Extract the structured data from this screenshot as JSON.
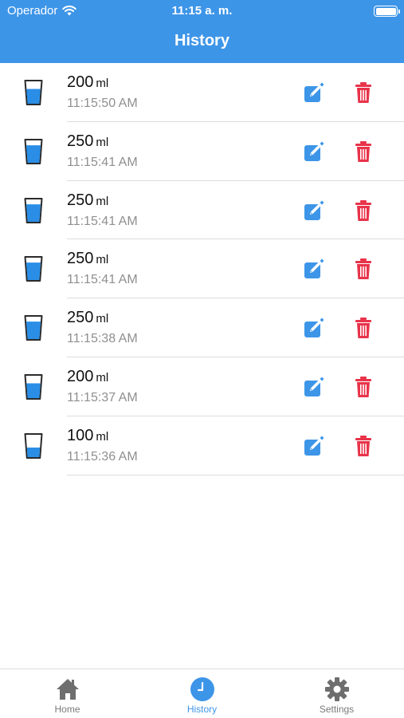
{
  "status_bar": {
    "carrier": "Operador",
    "time": "11:15 a. m."
  },
  "header": {
    "title": "History"
  },
  "colors": {
    "accent": "#3d95e8",
    "delete": "#e8334a",
    "water": "#2a8ee6"
  },
  "entries": [
    {
      "amount": "200",
      "unit": "ml",
      "time": "11:15:50 AM",
      "fill": 0.75
    },
    {
      "amount": "250",
      "unit": "ml",
      "time": "11:15:41 AM",
      "fill": 0.88
    },
    {
      "amount": "250",
      "unit": "ml",
      "time": "11:15:41 AM",
      "fill": 0.88
    },
    {
      "amount": "250",
      "unit": "ml",
      "time": "11:15:41 AM",
      "fill": 0.88
    },
    {
      "amount": "250",
      "unit": "ml",
      "time": "11:15:38 AM",
      "fill": 0.88
    },
    {
      "amount": "200",
      "unit": "ml",
      "time": "11:15:37 AM",
      "fill": 0.75
    },
    {
      "amount": "100",
      "unit": "ml",
      "time": "11:15:36 AM",
      "fill": 0.5
    }
  ],
  "tabbar": {
    "tabs": [
      {
        "label": "Home",
        "icon": "home-icon",
        "active": false
      },
      {
        "label": "History",
        "icon": "clock-icon",
        "active": true
      },
      {
        "label": "Settings",
        "icon": "gear-icon",
        "active": false
      }
    ]
  }
}
